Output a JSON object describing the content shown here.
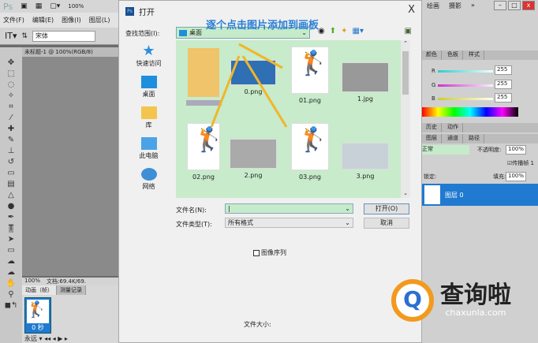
{
  "app": {
    "logo": "Ps",
    "zoom": "100%",
    "menus": [
      "文件(F)",
      "编辑(E)",
      "图像(I)",
      "图层(L)"
    ],
    "font": "宋体",
    "workspace": [
      "绘画",
      "摄影"
    ],
    "more": "»"
  },
  "document": {
    "tab": "未标题-1 @ 100%(RGB/8)",
    "zoom": "100%",
    "status": "文档:69.4K/69.",
    "panel_tabs": [
      "动画（帧）",
      "测量记录"
    ],
    "frame_time": "0 秒",
    "loop": "永远"
  },
  "dialog": {
    "title": "打开",
    "close": "X",
    "look_in_label": "查找范围(I):",
    "look_in_value": "桌面",
    "caption": "逐个点击图片添加到画板",
    "places": [
      "快速访问",
      "桌面",
      "库",
      "此电脑",
      "网络"
    ],
    "files": [
      {
        "name": ""
      },
      {
        "name": "0.png"
      },
      {
        "name": "01.png"
      },
      {
        "name": "1.jpg"
      },
      {
        "name": "02.png"
      },
      {
        "name": "2.png"
      },
      {
        "name": "03.png"
      },
      {
        "name": "3.png"
      }
    ],
    "filename_label": "文件名(N):",
    "filename_value": "",
    "filetype_label": "文件类型(T):",
    "filetype_value": "所有格式",
    "open_button": "打开(O)",
    "cancel_button": "取消",
    "image_sequence": "图像序列",
    "file_size": "文件大小:"
  },
  "panels": {
    "color_tabs": [
      "颜色",
      "色板",
      "样式"
    ],
    "r_label": "R",
    "g_label": "G",
    "b_label": "B",
    "r": "255",
    "g": "255",
    "b": "255",
    "history_tabs": [
      "历史",
      "动作"
    ],
    "layer_tabs": [
      "图层",
      "通道",
      "路径"
    ],
    "blend": "正常",
    "opacity_label": "不透明度:",
    "opacity": "100%",
    "propagate": "传播帧 1",
    "lock_label": "锁定:",
    "fill_label": "填充:",
    "fill": "100%",
    "layer_name": "图层 0"
  },
  "watermark": {
    "name": "查询啦",
    "domain": "chaxunla.com",
    "accent": "#f29a1f"
  }
}
